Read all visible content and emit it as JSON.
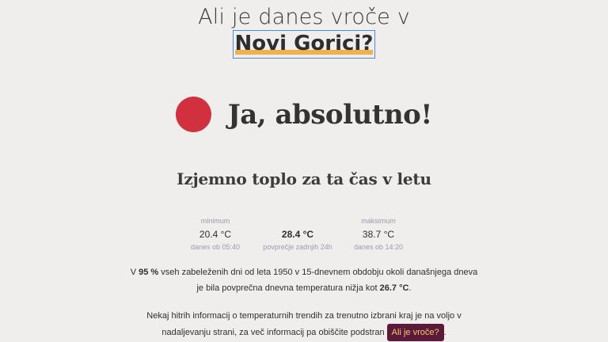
{
  "question": {
    "line1": "Ali je danes vroče v",
    "location": "Novi Gorici?"
  },
  "answer": {
    "text": "Ja, absolutno!",
    "indicator_color": "#d1303f"
  },
  "subtitle": "Izjemno toplo za ta čas v letu",
  "stats": {
    "minimum": {
      "label": "minimum",
      "value": "20.4 °C",
      "sub": "danes ob 05:40"
    },
    "average": {
      "value": "28.4 °C",
      "sub": "povprečje zadnjih 24h"
    },
    "maximum": {
      "label": "maksimum",
      "value": "38.7 °C",
      "sub": "danes ob 14:20"
    }
  },
  "paragraph1": {
    "t1": "V ",
    "pct": "95 %",
    "t2": " vseh zabeleženih dni od leta 1950 v 15-dnevnem obdobju okoli današnjega dneva je bila povprečna dnevna temperatura nižja kot ",
    "temp": "26.7 °C",
    "t3": "."
  },
  "paragraph2": {
    "text": "Nekaj hitrih informacij o temperaturnih trendih za trenutno izbrani kraj je na voljo v nadaljevanju strani, za več informacij pa obiščite podstran ",
    "link": "Ali je vroče?",
    "end": "."
  },
  "colors": {
    "background": "#f0eeec",
    "location_highlight": "#f3b04a",
    "badge_bg": "#5c1a3a",
    "badge_text": "#f3c76a"
  }
}
